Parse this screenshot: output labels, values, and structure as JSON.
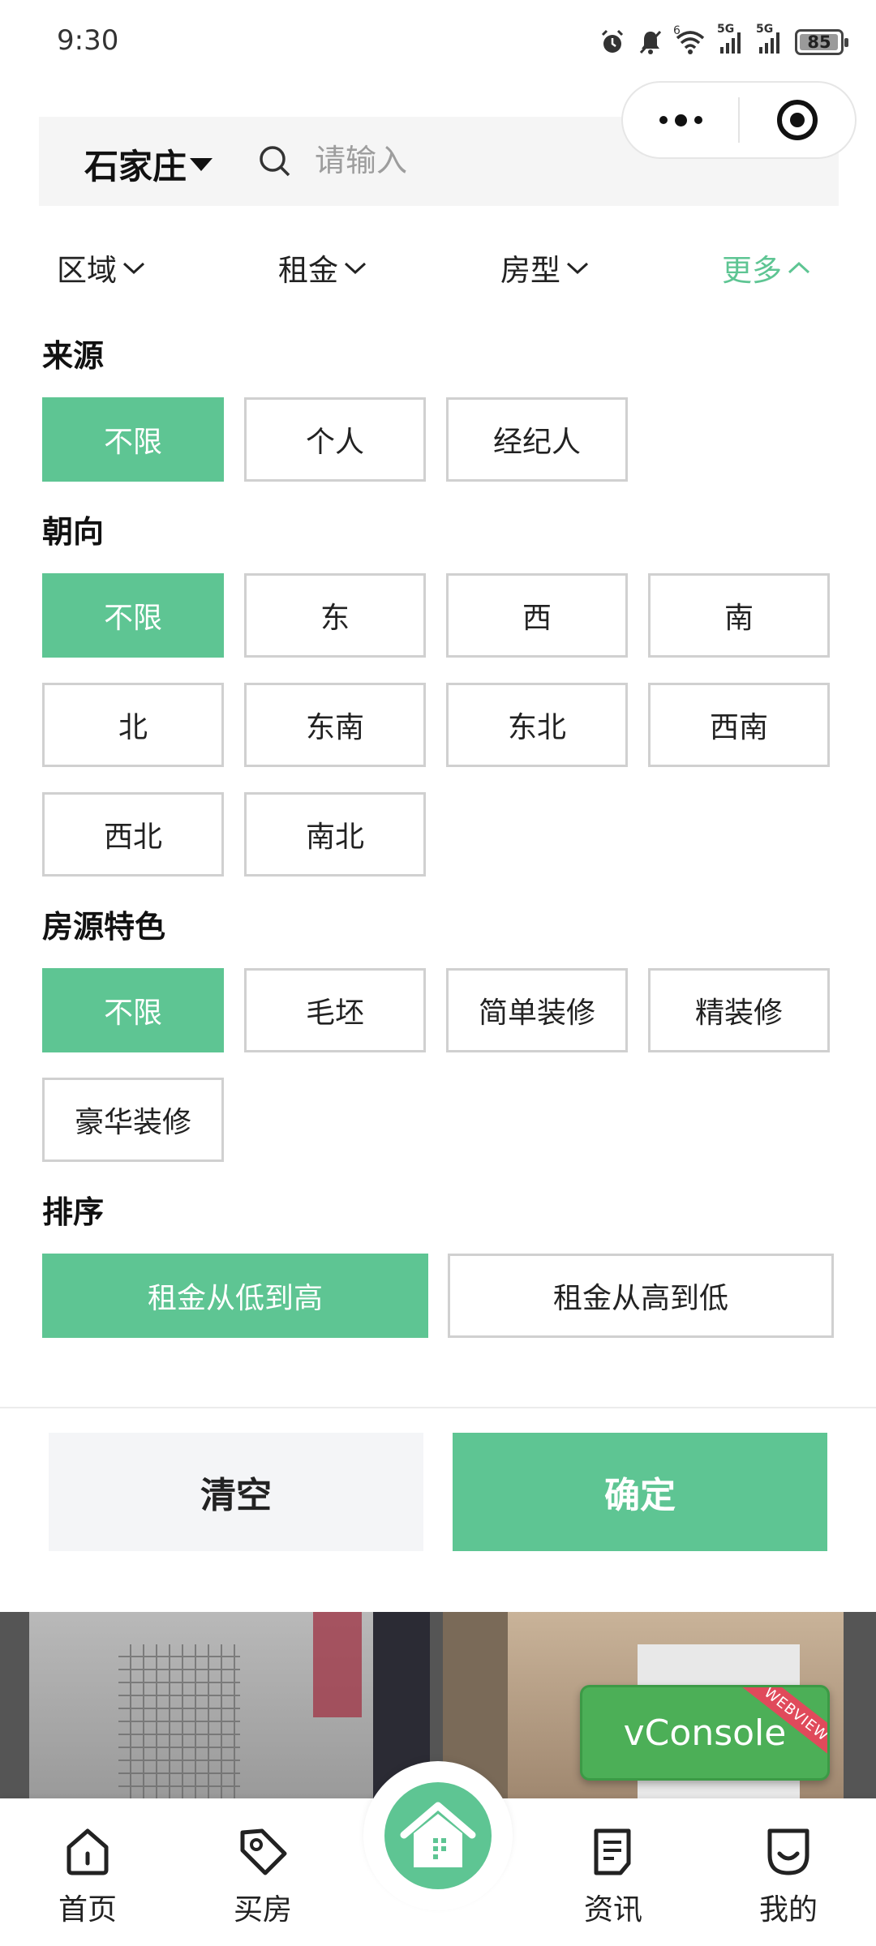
{
  "status_bar": {
    "time": "9:30",
    "battery": "85",
    "icons": [
      "alarm-icon",
      "mute-icon",
      "wifi-icon",
      "signal-5g-icon",
      "signal-5g-icon",
      "battery-icon"
    ],
    "network_labels": [
      "6",
      "5G",
      "5G"
    ]
  },
  "capsule": {
    "more_icon": "more-dots-icon",
    "close_icon": "target-icon"
  },
  "header": {
    "city": "石家庄",
    "search_placeholder": "请输入"
  },
  "filter_tabs": [
    {
      "label": "区域",
      "active": false
    },
    {
      "label": "租金",
      "active": false
    },
    {
      "label": "房型",
      "active": false
    },
    {
      "label": "更多",
      "active": true
    }
  ],
  "sections": {
    "source": {
      "title": "来源",
      "options": [
        "不限",
        "个人",
        "经纪人"
      ],
      "selected": "不限"
    },
    "orientation": {
      "title": "朝向",
      "options": [
        "不限",
        "东",
        "西",
        "南",
        "北",
        "东南",
        "东北",
        "西南",
        "西北",
        "南北"
      ],
      "selected": "不限"
    },
    "feature": {
      "title": "房源特色",
      "options": [
        "不限",
        "毛坯",
        "简单装修",
        "精装修",
        "豪华装修"
      ],
      "selected": "不限"
    },
    "sort": {
      "title": "排序",
      "options": [
        "租金从低到高",
        "租金从高到低"
      ],
      "selected": "租金从低到高"
    }
  },
  "actions": {
    "clear": "清空",
    "confirm": "确定"
  },
  "vconsole": {
    "label": "vConsole",
    "ribbon": "WEBVIEW"
  },
  "tabbar": {
    "items": [
      {
        "label": "首页",
        "icon": "home-outline-icon"
      },
      {
        "label": "买房",
        "icon": "tag-icon"
      },
      {
        "label": "资讯",
        "icon": "document-icon"
      },
      {
        "label": "我的",
        "icon": "smile-icon"
      }
    ],
    "center_icon": "building-home-icon"
  },
  "colors": {
    "accent": "#5ec593",
    "clear_bg": "#f4f5f7",
    "vconsole": "#4caf57"
  }
}
